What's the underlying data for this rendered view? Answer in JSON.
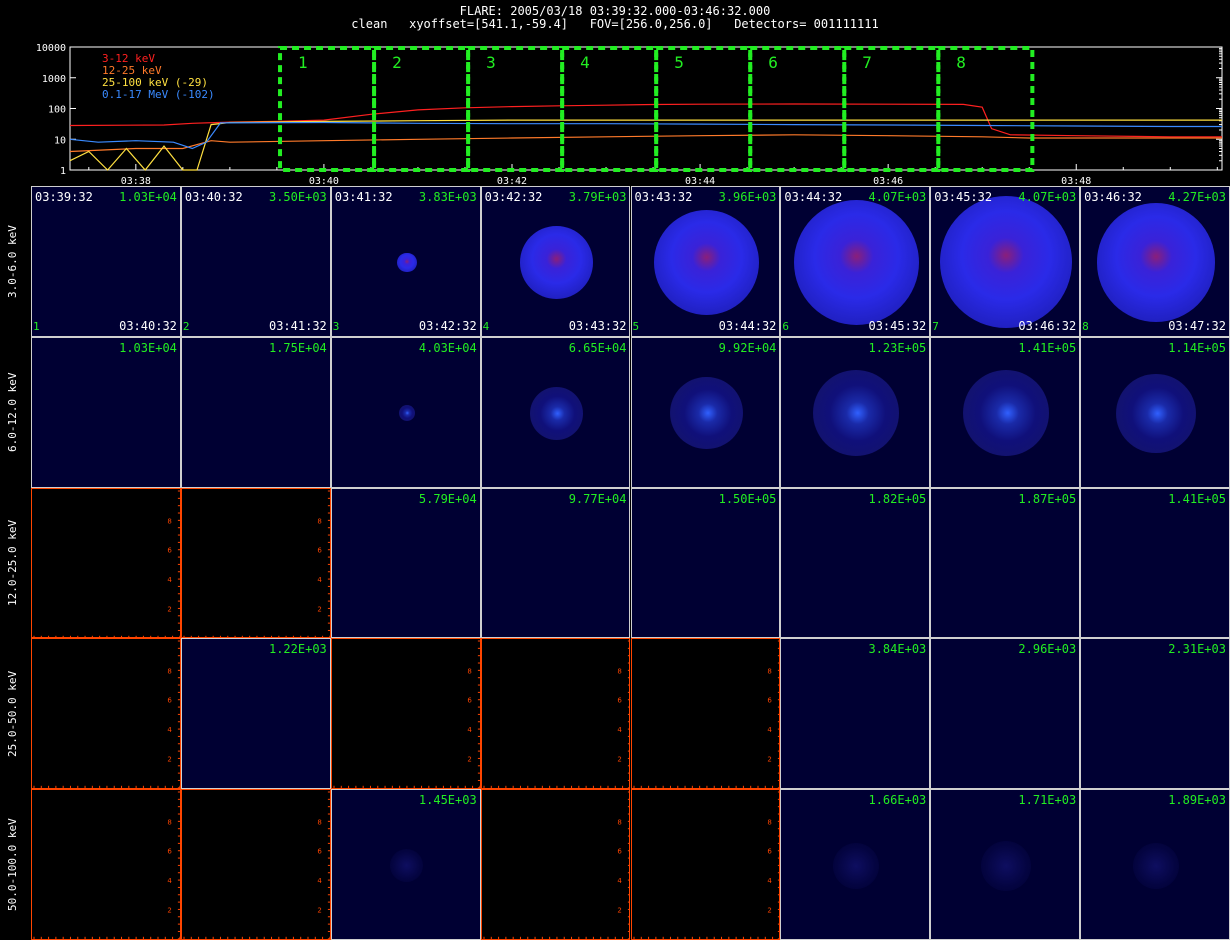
{
  "header": {
    "line1": "FLARE: 2005/03/18 03:39:32.000-03:46:32.000",
    "line2": "clean   xyoffset=[541.1,-59.4]   FOV=[256.0,256.0]   Detectors= 001111111"
  },
  "chart_data": {
    "type": "line",
    "xlabel": "",
    "ylabel": "",
    "yscale": "log",
    "ylim": [
      1,
      10000
    ],
    "ytick_labels": [
      "1",
      "10",
      "100",
      "1000",
      "10000"
    ],
    "xtick_labels": [
      "03:38",
      "03:40",
      "03:42",
      "03:44",
      "03:46",
      "03:48"
    ],
    "xtick_minutes": [
      38,
      40,
      42,
      44,
      46,
      48
    ],
    "xlim_minutes": [
      37.3,
      49.55
    ],
    "series": [
      {
        "name": "3-12 keV",
        "color": "#ff2020",
        "x": [
          37.3,
          38.3,
          38.6,
          39.0,
          39.5,
          40.0,
          40.5,
          41.0,
          41.5,
          42.0,
          42.5,
          43.0,
          43.5,
          44.0,
          45.0,
          46.0,
          46.8,
          47.0,
          47.1,
          47.3,
          48.0,
          49.0,
          49.55
        ],
        "y": [
          28,
          29,
          33,
          36,
          38,
          42,
          65,
          90,
          105,
          115,
          122,
          128,
          135,
          138,
          140,
          138,
          136,
          110,
          22,
          14,
          13,
          12,
          12
        ]
      },
      {
        "name": "12-25 keV",
        "color": "#ff7a2a",
        "x": [
          37.3,
          38.0,
          38.5,
          38.8,
          39.0,
          40.0,
          41.0,
          42.0,
          43.0,
          44.0,
          45.0,
          46.0,
          47.0,
          47.5,
          48.0,
          49.0,
          49.55
        ],
        "y": [
          4,
          5,
          5,
          9,
          8,
          9,
          10,
          11,
          12,
          13,
          14,
          13,
          12,
          11,
          11,
          11,
          11
        ]
      },
      {
        "name": "25-100 keV (-29)",
        "color": "#ffe040",
        "x": [
          37.3,
          37.5,
          37.7,
          37.9,
          38.1,
          38.3,
          38.5,
          38.65,
          38.8,
          39.0,
          40.0,
          41.0,
          42.0,
          43.0,
          44.0,
          45.0,
          46.0,
          47.0,
          48.0,
          49.0,
          49.55
        ],
        "y": [
          2,
          4,
          1,
          5,
          1,
          6,
          1,
          1,
          30,
          35,
          38,
          40,
          42,
          42,
          42,
          42,
          42,
          42,
          42,
          42,
          42
        ]
      },
      {
        "name": "0.1-17 MeV (-102)",
        "color": "#3a8aff",
        "x": [
          37.3,
          37.6,
          38.0,
          38.4,
          38.6,
          38.75,
          38.9,
          40.0,
          41.0,
          42.0,
          43.0,
          44.0,
          45.0,
          46.0,
          47.0,
          48.0,
          49.0,
          49.55
        ],
        "y": [
          10,
          8,
          9,
          8,
          5,
          8,
          34,
          35,
          33,
          32,
          32,
          31,
          30,
          29,
          28,
          27,
          26,
          26
        ]
      }
    ]
  },
  "intervals": [
    "1",
    "2",
    "3",
    "4",
    "5",
    "6",
    "7",
    "8"
  ],
  "energy_bands": [
    "3.0-6.0 keV",
    "6.0-12.0 keV",
    "12.0-25.0 keV",
    "25.0-50.0 keV",
    "50.0-100.0 keV"
  ],
  "start_times": [
    "03:39:32",
    "03:40:32",
    "03:41:32",
    "03:42:32",
    "03:43:32",
    "03:44:32",
    "03:45:32",
    "03:46:32"
  ],
  "end_times": [
    "03:40:32",
    "03:41:32",
    "03:42:32",
    "03:43:32",
    "03:44:32",
    "03:45:32",
    "03:46:32",
    "03:47:32"
  ],
  "image_grid": [
    [
      "1.03E+04",
      "3.50E+03",
      "3.83E+03",
      "3.79E+03",
      "3.96E+03",
      "4.07E+03",
      "4.07E+03",
      "4.27E+03"
    ],
    [
      "1.03E+04",
      "1.75E+04",
      "4.03E+04",
      "6.65E+04",
      "9.92E+04",
      "1.23E+05",
      "1.41E+05",
      "1.14E+05"
    ],
    [
      null,
      null,
      "5.79E+04",
      "9.77E+04",
      "1.50E+05",
      "1.82E+05",
      "1.87E+05",
      "1.41E+05"
    ],
    [
      null,
      "1.22E+03",
      null,
      null,
      null,
      "3.84E+03",
      "2.96E+03",
      "2.31E+03"
    ],
    [
      null,
      null,
      "1.45E+03",
      null,
      null,
      "1.66E+03",
      "1.71E+03",
      "1.89E+03"
    ]
  ],
  "empty_axis_ticks": [
    "2",
    "4",
    "6",
    "8"
  ],
  "colors": {
    "interval_box": "#22ee22",
    "empty_axis": "#ff4500",
    "image_bg": "#000033"
  }
}
